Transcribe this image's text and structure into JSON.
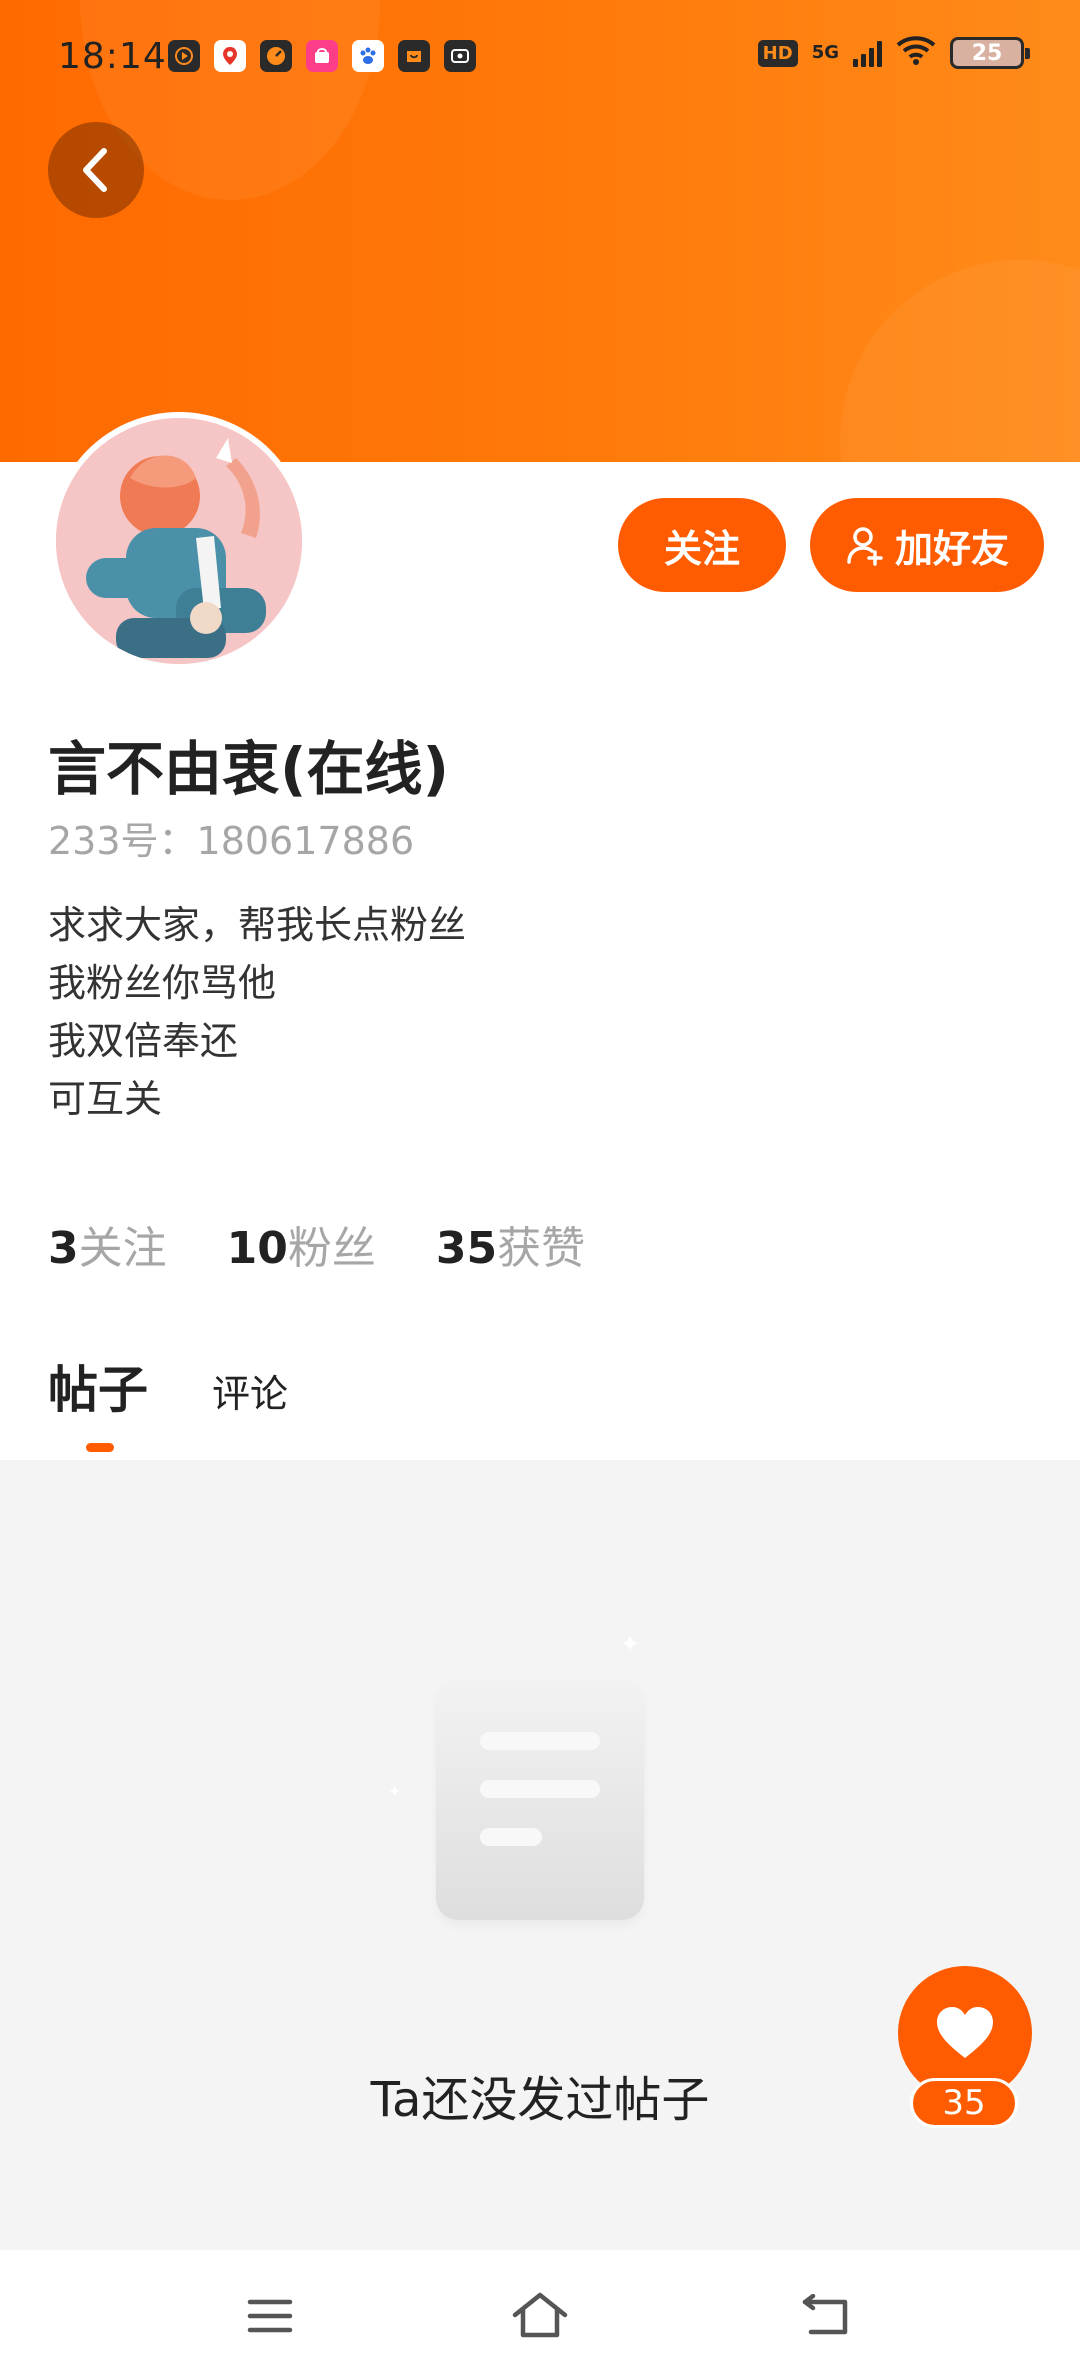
{
  "status_bar": {
    "time": "18:14",
    "network": "5G",
    "hd": "HD",
    "battery": "25"
  },
  "profile": {
    "name": "言不由衷(在线)",
    "uid": "233号：180617886",
    "bio": [
      "求求大家，帮我长点粉丝",
      "我粉丝你骂他",
      "我双倍奉还",
      "可互关"
    ],
    "follow_label": "关注",
    "add_friend_label": "加好友",
    "stats": [
      {
        "num": "3",
        "label": "关注"
      },
      {
        "num": "10",
        "label": "粉丝"
      },
      {
        "num": "35",
        "label": "获赞"
      }
    ]
  },
  "tabs": [
    {
      "label": "帖子",
      "active": true
    },
    {
      "label": "评论",
      "active": false
    }
  ],
  "content": {
    "empty_text": "Ta还没发过帖子"
  },
  "like": {
    "count": "35"
  },
  "colors": {
    "accent": "#ff5b00",
    "banner": "#ff7a0a"
  }
}
